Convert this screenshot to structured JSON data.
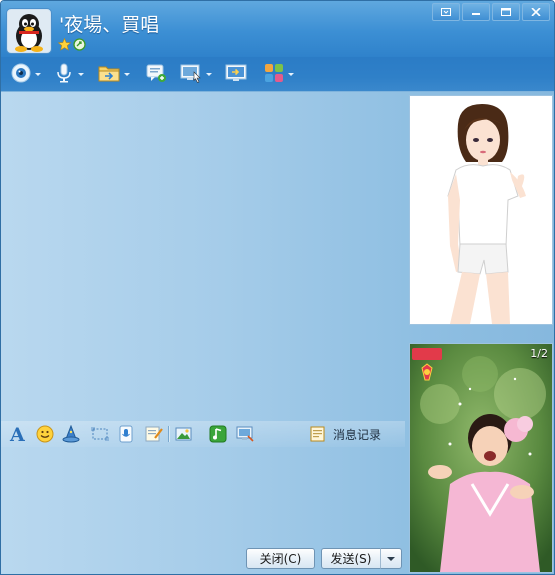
{
  "header": {
    "contact_name": "'夜場、買唱",
    "status_icons": [
      "star-icon",
      "qq-level-icon"
    ]
  },
  "window_controls": [
    "menu-icon",
    "minimize-icon",
    "maximize-icon",
    "close-icon"
  ],
  "toolbar": {
    "items": [
      {
        "icon": "video-camera-icon",
        "dropdown": true
      },
      {
        "icon": "microphone-icon",
        "dropdown": true
      },
      {
        "icon": "file-transfer-icon",
        "dropdown": true
      },
      {
        "icon": "message-create-icon",
        "dropdown": false
      },
      {
        "icon": "remote-desktop-icon",
        "dropdown": true
      },
      {
        "icon": "screen-share-icon",
        "dropdown": false
      },
      {
        "icon": "apps-icon",
        "dropdown": true
      }
    ]
  },
  "format_bar": {
    "history_label": "消息记录"
  },
  "buttons": {
    "close_label": "关闭(C)",
    "send_label": "发送(S)"
  },
  "photo_panel": {
    "page_indicator": "1/2"
  },
  "colors": {
    "title_bar": "#3c8fd4",
    "toolbar": "#2f80c8",
    "chat_bg": "#a5cce9"
  }
}
